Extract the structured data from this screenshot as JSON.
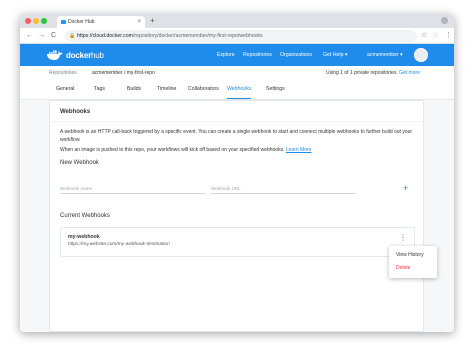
{
  "browser": {
    "tab_title": "Docker Hub",
    "tab_close": "×",
    "new_tab": "+",
    "url_host": "https://cloud.docker.com",
    "url_path": "/repository/docker/acmemember/my-first-repo/webhooks",
    "back": "←",
    "forward": "→",
    "reload": "C",
    "star": "☆",
    "menu": "⋮"
  },
  "header": {
    "logo_text_bold": "docker",
    "logo_text": "hub",
    "nav": [
      "Explore",
      "Repositories",
      "Organizations",
      "Get Help ▾"
    ],
    "username": "acmemember ▾"
  },
  "repo_bar": {
    "label": "Repositories",
    "repo": "acmemember / my-first-repo",
    "usage_text": "Using 1 of 1 private repositories.",
    "usage_link": "Get more"
  },
  "tabs": [
    "General",
    "Tags",
    "Builds",
    "Timeline",
    "Collaborators",
    "Webhooks",
    "Settings"
  ],
  "active_tab": "Webhooks",
  "card": {
    "title": "Webhooks",
    "desc1": "A webhook is an HTTP call-back triggered by a specific event. You can create a single webhook to start and connect multiple webhooks to further build out your workflow.",
    "desc2": "When an image is pushed to this repo, your workflows will kick off based on your specified webhooks.",
    "learn_more": "Learn More",
    "new_webhook_label": "New Webhook",
    "name_placeholder": "Webhook name",
    "url_placeholder": "Webhook URL",
    "add_button": "+",
    "current_label": "Current Webhooks",
    "webhooks": [
      {
        "name": "my-webhook",
        "url": "https://my.website.com/my-webhook-destination"
      }
    ],
    "kebab": "⋮"
  },
  "menu": {
    "view_history": "View History",
    "delete": "Delete"
  },
  "colors": {
    "brand": "#1f8ceb",
    "danger": "#e0413b"
  }
}
